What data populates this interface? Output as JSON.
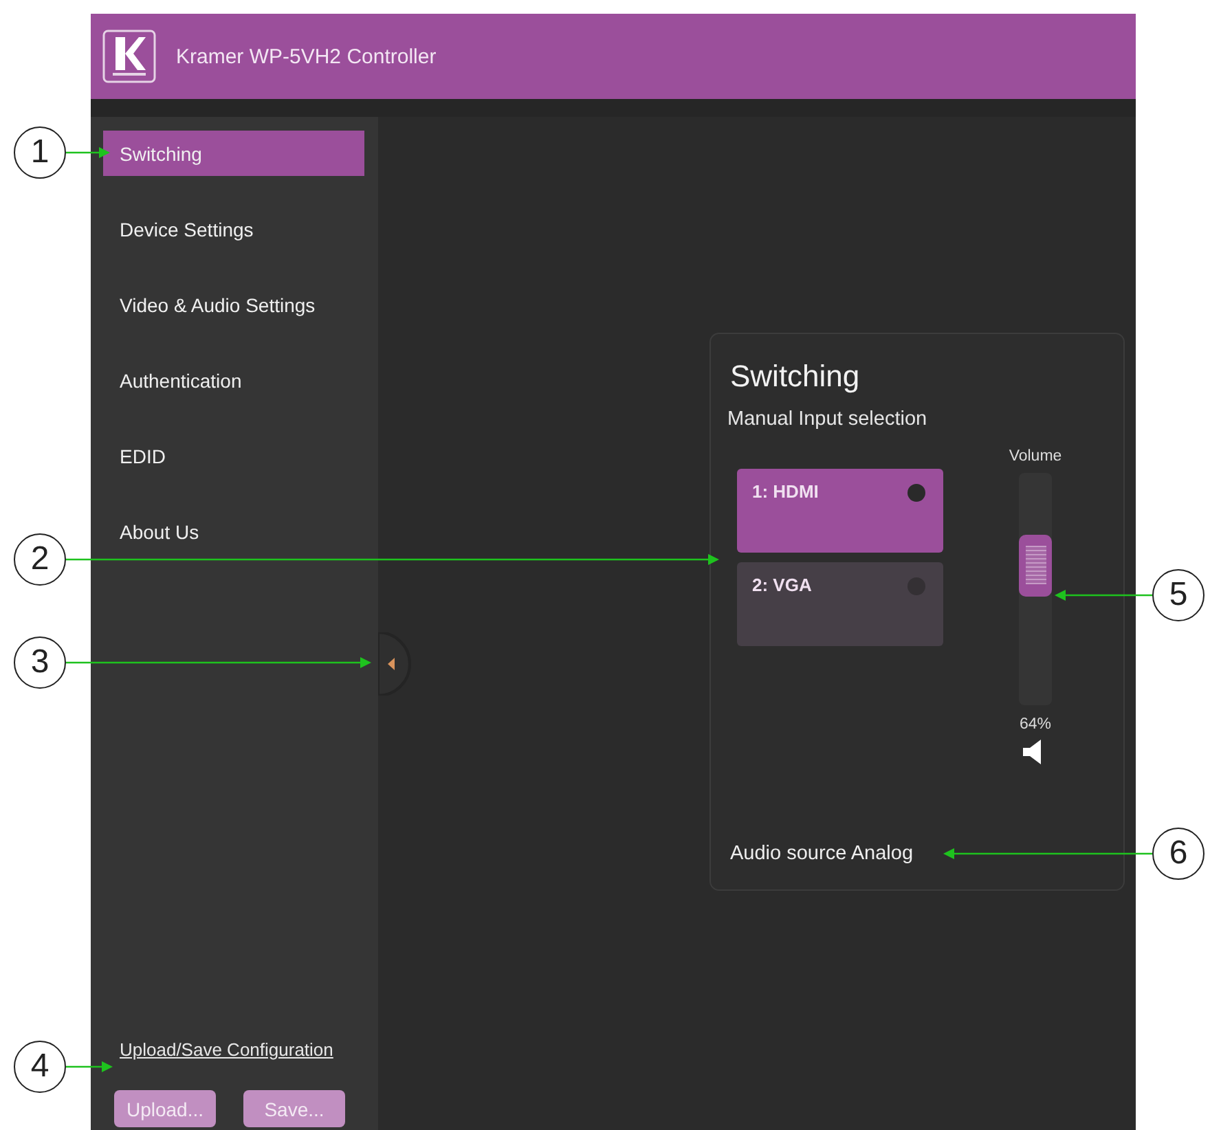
{
  "header": {
    "title": "Kramer WP-5VH2 Controller"
  },
  "sidebar": {
    "items": [
      {
        "label": "Switching",
        "selected": true
      },
      {
        "label": "Device Settings",
        "selected": false
      },
      {
        "label": "Video & Audio Settings",
        "selected": false
      },
      {
        "label": "Authentication",
        "selected": false
      },
      {
        "label": "EDID",
        "selected": false
      },
      {
        "label": "About Us",
        "selected": false
      }
    ],
    "config_link": "Upload/Save Configuration",
    "buttons": [
      "Upload...",
      "Save..."
    ]
  },
  "panel": {
    "title": "Switching",
    "subtitle": "Manual Input selection",
    "inputs": [
      {
        "label": "1: HDMI",
        "selected": true
      },
      {
        "label": "2: VGA",
        "selected": false
      }
    ],
    "volume": {
      "label": "Volume",
      "level": 0.64,
      "reading": "64%"
    },
    "audio_source": "Audio source Analog"
  },
  "callouts": [
    {
      "number": "1"
    },
    {
      "number": "2"
    },
    {
      "number": "3"
    },
    {
      "number": "4"
    },
    {
      "number": "5"
    },
    {
      "number": "6"
    }
  ]
}
